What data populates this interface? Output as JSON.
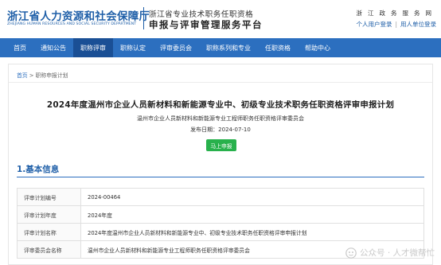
{
  "header": {
    "org_name_cn": "浙江省人力资源和社会保障厅",
    "org_name_en": "ZHEJIANG HUMAN RESOURCES AND SOCIAL SECURITY DEPARTMENT",
    "system_subtitle": "浙江省专业技术职务任职资格",
    "system_title": "申报与评审管理服务平台",
    "top_links": [
      "浙",
      "江",
      "政",
      "务",
      "服",
      "务",
      "网"
    ],
    "personal_login": "个人用户登录",
    "separator": "|",
    "employer_login": "用人单位登录"
  },
  "nav": {
    "items": [
      {
        "label": "首页",
        "active": false
      },
      {
        "label": "通知公告",
        "active": false
      },
      {
        "label": "职称评审",
        "active": true
      },
      {
        "label": "职称认定",
        "active": false
      },
      {
        "label": "评审委员会",
        "active": false
      },
      {
        "label": "职称系列和专业",
        "active": false
      },
      {
        "label": "任职资格",
        "active": false
      },
      {
        "label": "帮助中心",
        "active": false
      }
    ]
  },
  "breadcrumb": {
    "home": "首页",
    "separator": ">",
    "current": "职称申报计划"
  },
  "main": {
    "title": "2024年度温州市企业人员新材料和新能源专业中、初级专业技术职务任职资格评审申报计划",
    "issuer": "温州市企业人员新材料和新能源专业工程师职务任职资格评审委员会",
    "date_label": "发布日期：",
    "date_value": "2024-07-10",
    "apply_button": "马上申报",
    "section_title": "1.基本信息",
    "rows": [
      {
        "label": "评审计划编号",
        "value": "2024-00464"
      },
      {
        "label": "评审计划年度",
        "value": "2024年度"
      },
      {
        "label": "评审计划名称",
        "value": "2024年度温州市企业人员新材料和新能源专业中、初级专业技术职务任职资格评审申报计划"
      },
      {
        "label": "评审委员会名称",
        "value": "温州市企业人员新材料和新能源专业工程师职务任职资格评审委员会"
      }
    ]
  },
  "watermark": {
    "text": "公众号 · 人才微帮忙"
  },
  "colors": {
    "brand_blue": "#1f5fa8",
    "nav_bg": "#2c6fbf",
    "nav_active": "#1a4f95",
    "apply_green": "#28b14c"
  }
}
